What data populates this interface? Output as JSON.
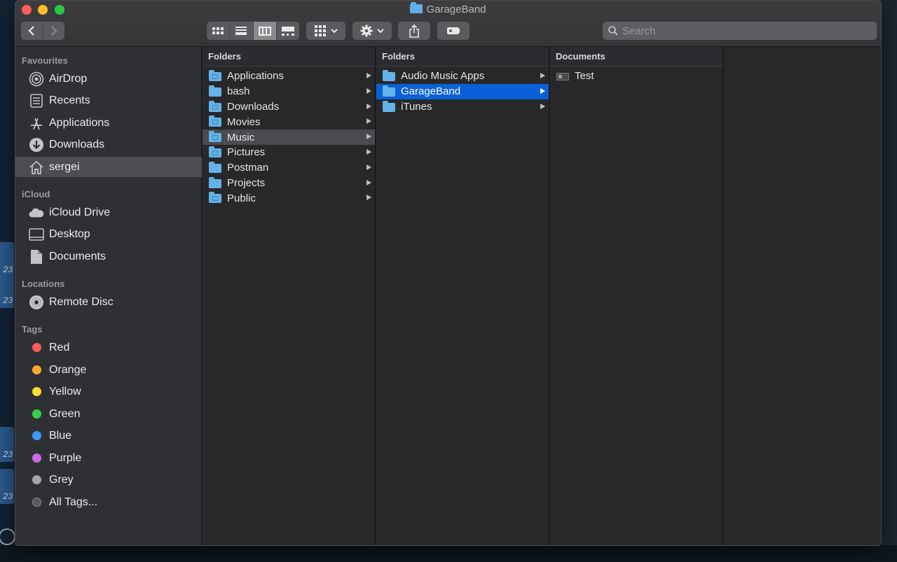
{
  "window": {
    "title": "GarageBand"
  },
  "toolbar": {
    "back_icon": "chevron-left-icon",
    "forward_icon": "chevron-right-icon",
    "view_modes": [
      "icon-view",
      "list-view",
      "column-view",
      "gallery-view"
    ],
    "active_view": "column-view",
    "search_placeholder": "Search"
  },
  "sidebar": {
    "favourites_heading": "Favourites",
    "favourites": [
      {
        "label": "AirDrop",
        "icon": "airdrop-icon"
      },
      {
        "label": "Recents",
        "icon": "recents-icon"
      },
      {
        "label": "Applications",
        "icon": "applications-icon"
      },
      {
        "label": "Downloads",
        "icon": "downloads-icon"
      },
      {
        "label": "sergei",
        "icon": "home-icon",
        "selected": true
      }
    ],
    "icloud_heading": "iCloud",
    "icloud": [
      {
        "label": "iCloud Drive",
        "icon": "cloud-icon"
      },
      {
        "label": "Desktop",
        "icon": "desktop-icon"
      },
      {
        "label": "Documents",
        "icon": "document-icon"
      }
    ],
    "locations_heading": "Locations",
    "locations": [
      {
        "label": "Remote Disc",
        "icon": "disc-icon"
      }
    ],
    "tags_heading": "Tags",
    "tags": [
      {
        "label": "Red",
        "color": "#fe5b5b"
      },
      {
        "label": "Orange",
        "color": "#fda82a"
      },
      {
        "label": "Yellow",
        "color": "#fee02b"
      },
      {
        "label": "Green",
        "color": "#39d24b"
      },
      {
        "label": "Blue",
        "color": "#3d9bff"
      },
      {
        "label": "Purple",
        "color": "#c96ce8"
      },
      {
        "label": "Grey",
        "color": "#a5a5a8"
      },
      {
        "label": "All Tags...",
        "color": "#5a5a5e"
      }
    ]
  },
  "columns": [
    {
      "heading": "Folders",
      "items": [
        {
          "label": "Applications"
        },
        {
          "label": "bash"
        },
        {
          "label": "Downloads"
        },
        {
          "label": "Movies"
        },
        {
          "label": "Music",
          "selected": "gray"
        },
        {
          "label": "Pictures"
        },
        {
          "label": "Postman"
        },
        {
          "label": "Projects"
        },
        {
          "label": "Public"
        }
      ]
    },
    {
      "heading": "Folders",
      "items": [
        {
          "label": "Audio Music Apps"
        },
        {
          "label": "GarageBand",
          "selected": "blue"
        },
        {
          "label": "iTunes"
        }
      ]
    },
    {
      "heading": "Documents",
      "items": [
        {
          "label": "Test",
          "type": "file"
        }
      ]
    }
  ]
}
